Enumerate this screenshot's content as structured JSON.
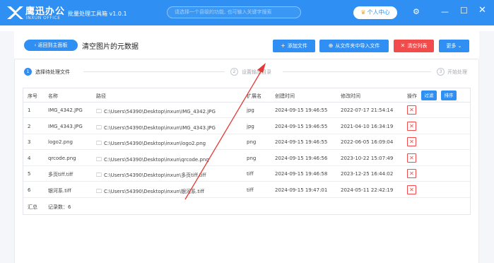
{
  "titlebar": {
    "brand_name": "鹰迅办公",
    "brand_sub": "INXUN OFFICE",
    "app_title": "批量处理工具箱 v1.0.1",
    "search_placeholder": "请选择一个县级的功能, 也可输入关键字搜索",
    "user_center_label": "个人中心",
    "icons": [
      "crown-icon",
      "gear-icon",
      "minimize-icon",
      "maximize-icon",
      "close-icon"
    ]
  },
  "header": {
    "back_label": "返回到主面板",
    "page_title": "清空图片的元数据",
    "buttons": {
      "add_file": "添加文件",
      "import_folder": "从文件夹中导入文件",
      "clear_list": "清空列表",
      "more": "更多"
    }
  },
  "steps": [
    {
      "num": "1",
      "label": "选择待处理文件"
    },
    {
      "num": "2",
      "label": "设置输出目录"
    },
    {
      "num": "3",
      "label": "开始处理"
    }
  ],
  "table": {
    "columns": [
      "序号",
      "名称",
      "路径",
      "扩展名",
      "创建时间",
      "修改时间",
      "操作"
    ],
    "filter_label": "过滤",
    "sort_label": "排序",
    "rows": [
      {
        "idx": "1",
        "name": "IMG_4342.JPG",
        "path": "C:\\Users\\54390\\Desktop\\inxun\\IMG_4342.JPG",
        "ext": "jpg",
        "created": "2024-09-15 19:46:55",
        "modified": "2022-07-17 21:54:14"
      },
      {
        "idx": "2",
        "name": "IMG_4343.JPG",
        "path": "C:\\Users\\54390\\Desktop\\inxun\\IMG_4343.JPG",
        "ext": "jpg",
        "created": "2024-09-15 19:46:55",
        "modified": "2021-04-10 16:34:19"
      },
      {
        "idx": "3",
        "name": "logo2.png",
        "path": "C:\\Users\\54390\\Desktop\\inxun\\logo2.png",
        "ext": "png",
        "created": "2024-09-15 19:46:55",
        "modified": "2022-06-05 16:09:04"
      },
      {
        "idx": "4",
        "name": "qrcode.png",
        "path": "C:\\Users\\54390\\Desktop\\inxun\\qrcode.png",
        "ext": "png",
        "created": "2024-09-15 19:46:56",
        "modified": "2023-10-22 15:07:49"
      },
      {
        "idx": "5",
        "name": "多页tiff.tiff",
        "path": "C:\\Users\\54390\\Desktop\\inxun\\多页tiff.tiff",
        "ext": "tiff",
        "created": "2024-09-15 19:46:58",
        "modified": "2023-12-25 16:44:02"
      },
      {
        "idx": "6",
        "name": "银河系.tiff",
        "path": "C:\\Users\\54390\\Desktop\\inxun\\银河系.tiff",
        "ext": "tiff",
        "created": "2024-09-15 19:47:01",
        "modified": "2024-05-11 22:42:19"
      }
    ],
    "summary_label": "汇总",
    "record_count": "记录数：6"
  },
  "colors": {
    "accent": "#2f8ff2",
    "danger": "#f14b4b",
    "annotation_arrow": "#e53935"
  }
}
